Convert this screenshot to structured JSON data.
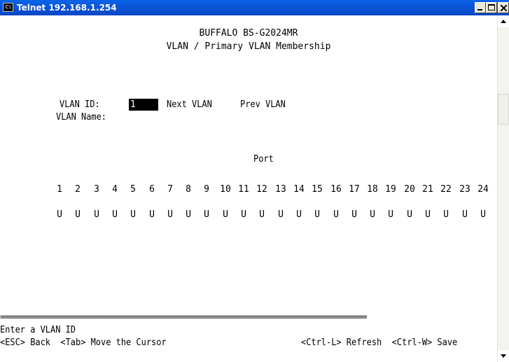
{
  "window": {
    "title": "Telnet 192.168.1.254",
    "icon_label": "C:\\"
  },
  "header": {
    "device": "BUFFALO BS-G2024MR",
    "screen": "VLAN / Primary VLAN Membership"
  },
  "form": {
    "vlan_id_label": "VLAN ID:",
    "vlan_id_value": "1",
    "next_vlan": "Next VLAN",
    "prev_vlan": "Prev VLAN",
    "vlan_name_label": "VLAN Name:"
  },
  "ports": {
    "heading": "Port",
    "numbers": [
      "1",
      "2",
      "3",
      "4",
      "5",
      "6",
      "7",
      "8",
      "9",
      "10",
      "11",
      "12",
      "13",
      "14",
      "15",
      "16",
      "17",
      "18",
      "19",
      "20",
      "21",
      "22",
      "23",
      "24"
    ],
    "membership": [
      "U",
      "U",
      "U",
      "U",
      "U",
      "U",
      "U",
      "U",
      "U",
      "U",
      "U",
      "U",
      "U",
      "U",
      "U",
      "U",
      "U",
      "U",
      "U",
      "U",
      "U",
      "U",
      "U",
      "U"
    ]
  },
  "footer": {
    "separator": "===============================================================================",
    "prompt": "Enter a VLAN ID",
    "help_left": "<ESC> Back  <Tab> Move the Cursor",
    "help_right": "<Ctrl-L> Refresh  <Ctrl-W> Save"
  }
}
